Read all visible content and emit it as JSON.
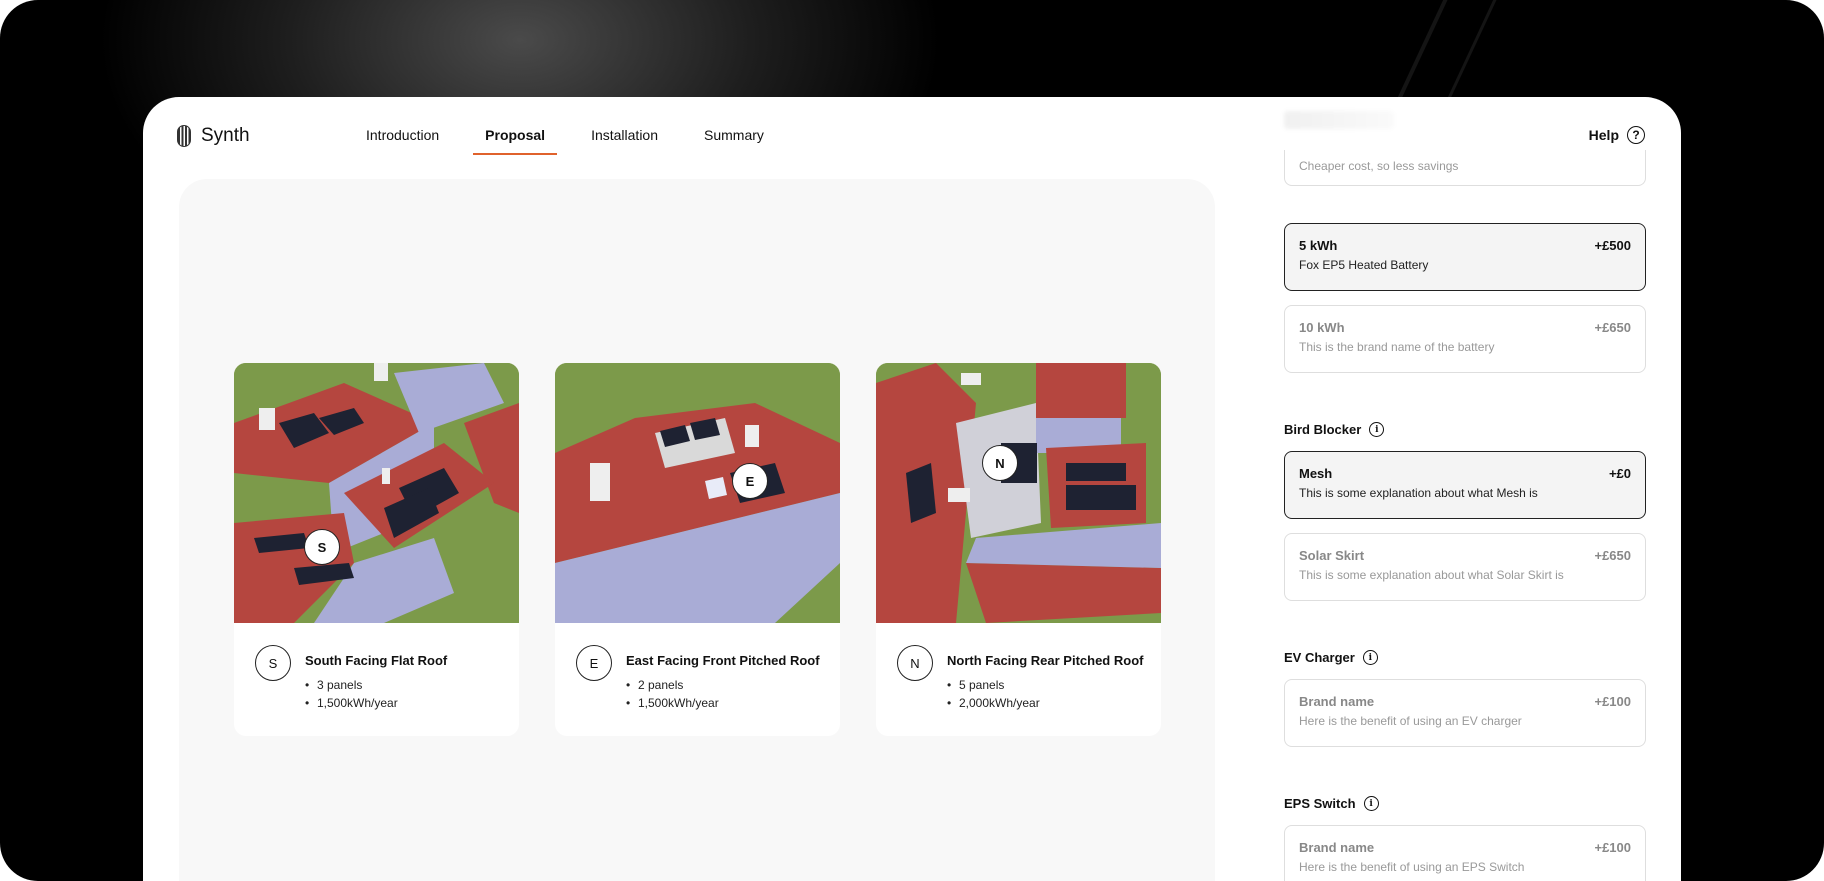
{
  "app": {
    "name": "Synth"
  },
  "nav": {
    "items": [
      {
        "label": "Introduction",
        "active": false
      },
      {
        "label": "Proposal",
        "active": true
      },
      {
        "label": "Installation",
        "active": false
      },
      {
        "label": "Summary",
        "active": false
      }
    ],
    "help_label": "Help"
  },
  "roofs": [
    {
      "direction": "S",
      "title": "South Facing Flat Roof",
      "details": [
        "3 panels",
        "1,500kWh/year"
      ]
    },
    {
      "direction": "E",
      "title": "East Facing Front Pitched Roof",
      "details": [
        "2 panels",
        "1,500kWh/year"
      ]
    },
    {
      "direction": "N",
      "title": "North Facing Rear Pitched Roof",
      "details": [
        "5 panels",
        "2,000kWh/year"
      ]
    }
  ],
  "battery": {
    "partial_desc": "Cheaper cost, so less savings",
    "options": [
      {
        "title": "5 kWh",
        "desc": "Fox EP5 Heated Battery",
        "price": "+£500",
        "selected": true
      },
      {
        "title": "10 kWh",
        "desc": "This is the brand name of the battery",
        "price": "+£650",
        "selected": false
      }
    ]
  },
  "bird_blocker": {
    "label": "Bird Blocker",
    "options": [
      {
        "title": "Mesh",
        "desc": "This is some explanation about what Mesh is",
        "price": "+£0",
        "selected": true
      },
      {
        "title": "Solar Skirt",
        "desc": "This is some explanation about what Solar Skirt is",
        "price": "+£650",
        "selected": false
      }
    ]
  },
  "ev_charger": {
    "label": "EV Charger",
    "options": [
      {
        "title": "Brand name",
        "desc": "Here is the benefit of using an EV charger",
        "price": "+£100",
        "selected": false
      }
    ]
  },
  "eps_switch": {
    "label": "EPS Switch",
    "options": [
      {
        "title": "Brand name",
        "desc": "Here is the benefit of using an EPS Switch",
        "price": "+£100",
        "selected": false
      }
    ]
  },
  "colors": {
    "accent": "#e0622c",
    "roof": "#b5463f",
    "grass": "#7c9a4a",
    "wall": "#a9acd6"
  },
  "icons": {
    "help": "question-circle-icon",
    "info": "info-circle-icon",
    "logo": "fingerprint-logo-icon"
  }
}
